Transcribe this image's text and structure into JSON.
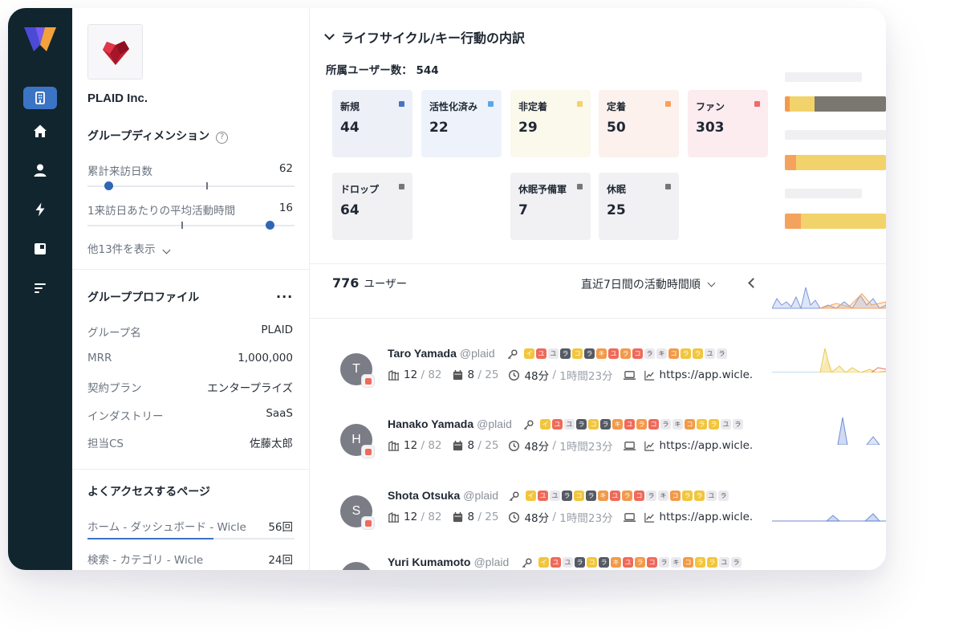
{
  "company": {
    "name": "PLAID Inc."
  },
  "dimensions": {
    "title": "グループディメンション",
    "help": "?",
    "items": [
      {
        "label": "累計来訪日数",
        "value": "62",
        "level": 0.1
      },
      {
        "label": "1来訪日あたりの平均活動時間",
        "value": "16",
        "level": 0.88
      }
    ],
    "show_more": "他13件を表示"
  },
  "profile": {
    "title": "グループプロファイル",
    "more": "···",
    "rows": [
      {
        "key": "グループ名",
        "value": "PLAID"
      },
      {
        "key": "MRR",
        "value": "1,000,000"
      },
      {
        "key": "契約プラン",
        "value": "エンタープライズ"
      },
      {
        "key": "インダストリー",
        "value": "SaaS"
      },
      {
        "key": "担当CS",
        "value": "佐藤太郎"
      }
    ]
  },
  "pages": {
    "title": "よくアクセスするページ",
    "rows": [
      {
        "name": "ホーム - ダッシュボード - Wicle",
        "count": "56回",
        "level": 0.61
      },
      {
        "name": "検索 - カテゴリ - Wicle",
        "count": "24回"
      }
    ]
  },
  "lifecycle": {
    "title": "ライフサイクル/キー行動の内訳",
    "member_label": "所属ユーザー数：",
    "member_count": "544",
    "cards": [
      {
        "label": "新規",
        "value": "44",
        "bg": "#eef0f8",
        "flag": "#4a72c4"
      },
      {
        "label": "活性化済み",
        "value": "22",
        "bg": "#eef3fb",
        "flag": "#5aa7e6"
      },
      {
        "label": "非定着",
        "value": "29",
        "bg": "#fbf8ec",
        "flag": "#f2d36b"
      },
      {
        "label": "定着",
        "value": "50",
        "bg": "#fcf1ec",
        "flag": "#f5a25c"
      },
      {
        "label": "ファン",
        "value": "303",
        "bg": "#fcecef",
        "flag": "#ef6a6a"
      },
      {
        "label": "ドロップ",
        "value": "64",
        "bg": "#f1f1f4",
        "flag": "#777"
      },
      {
        "label": "休眠予備軍",
        "value": "7",
        "bg": "#f1f1f4",
        "flag": "#777"
      },
      {
        "label": "休眠",
        "value": "25",
        "bg": "#f1f1f4",
        "flag": "#777"
      }
    ]
  },
  "users": {
    "count": "776",
    "count_unit": "ユーザー",
    "sort_label": "直近7日間の活動時間順",
    "list": [
      {
        "initial": "T",
        "name": "Taro Yamada",
        "handle": "@plaid",
        "a": "12",
        "b": "82",
        "c": "8",
        "d": "25",
        "time": "48分",
        "total": "1時間23分",
        "url": "https://app.wicle."
      },
      {
        "initial": "H",
        "name": "Hanako Yamada",
        "handle": "@plaid",
        "a": "12",
        "b": "82",
        "c": "8",
        "d": "25",
        "time": "48分",
        "total": "1時間23分",
        "url": "https://app.wicle."
      },
      {
        "initial": "S",
        "name": "Shota Otsuka",
        "handle": "@plaid",
        "a": "12",
        "b": "82",
        "c": "8",
        "d": "25",
        "time": "48分",
        "total": "1時間23分",
        "url": "https://app.wicle."
      },
      {
        "initial": "",
        "name": "Yuri Kumamoto",
        "handle": "@plaid",
        "a": "",
        "b": "",
        "c": "",
        "d": "",
        "time": "",
        "total": "",
        "url": ""
      }
    ],
    "chips": [
      {
        "t": "イ",
        "c": "#f2c53d"
      },
      {
        "t": "ユ",
        "c": "#ef6a5a"
      },
      {
        "t": "ユ",
        "c": "#e9e9ee",
        "dark": true
      },
      {
        "t": "ラ",
        "c": "#555a63"
      },
      {
        "t": "コ",
        "c": "#f2c53d"
      },
      {
        "t": "ラ",
        "c": "#555a63"
      },
      {
        "t": "キ",
        "c": "#f29a4a"
      },
      {
        "t": "ユ",
        "c": "#ef6a5a"
      },
      {
        "t": "ラ",
        "c": "#f29a4a"
      },
      {
        "t": "コ",
        "c": "#ef6a5a"
      },
      {
        "t": "ラ",
        "c": "#e9e9ee",
        "dark": true
      },
      {
        "t": "キ",
        "c": "#e9e9ee",
        "dark": true
      },
      {
        "t": "コ",
        "c": "#f29a4a"
      },
      {
        "t": "ラ",
        "c": "#f2c53d"
      },
      {
        "t": "ラ",
        "c": "#f2c53d"
      },
      {
        "t": "ユ",
        "c": "#e9e9ee",
        "dark": true
      },
      {
        "t": "ラ",
        "c": "#e9e9ee",
        "dark": true
      }
    ]
  }
}
